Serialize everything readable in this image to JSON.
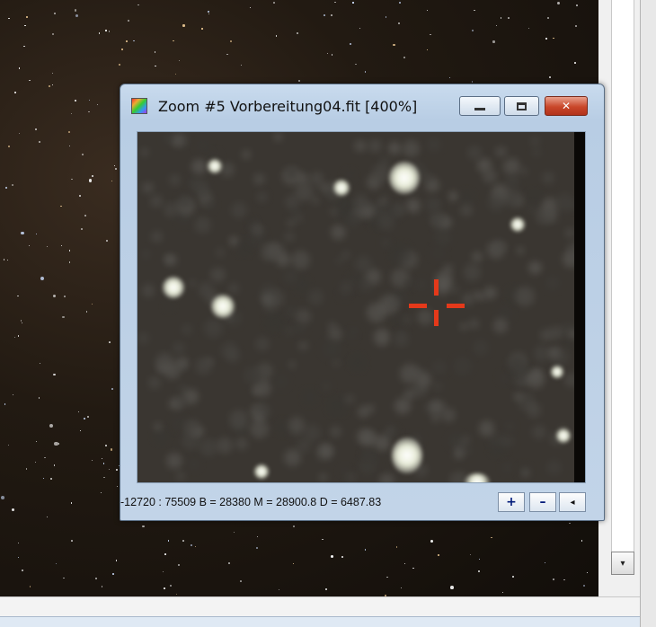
{
  "zoom_window": {
    "title": "Zoom #5 Vorbereitung04.fit  [400%]",
    "status": "-12720 : 75509  B = 28380  M = 28900.8  D = 6487.83",
    "buttons": {
      "plus": "+",
      "minus": "–",
      "left": "◂"
    },
    "caption_buttons": {
      "close": "✕"
    }
  },
  "scrollbar": {
    "down_arrow": "▾"
  },
  "colors": {
    "crosshair": "#e4391a",
    "close_button": "#c9472a"
  },
  "icons": [
    "zoom-window-app-icon",
    "minimize-icon",
    "maximize-icon",
    "close-icon",
    "scroll-down-icon"
  ]
}
